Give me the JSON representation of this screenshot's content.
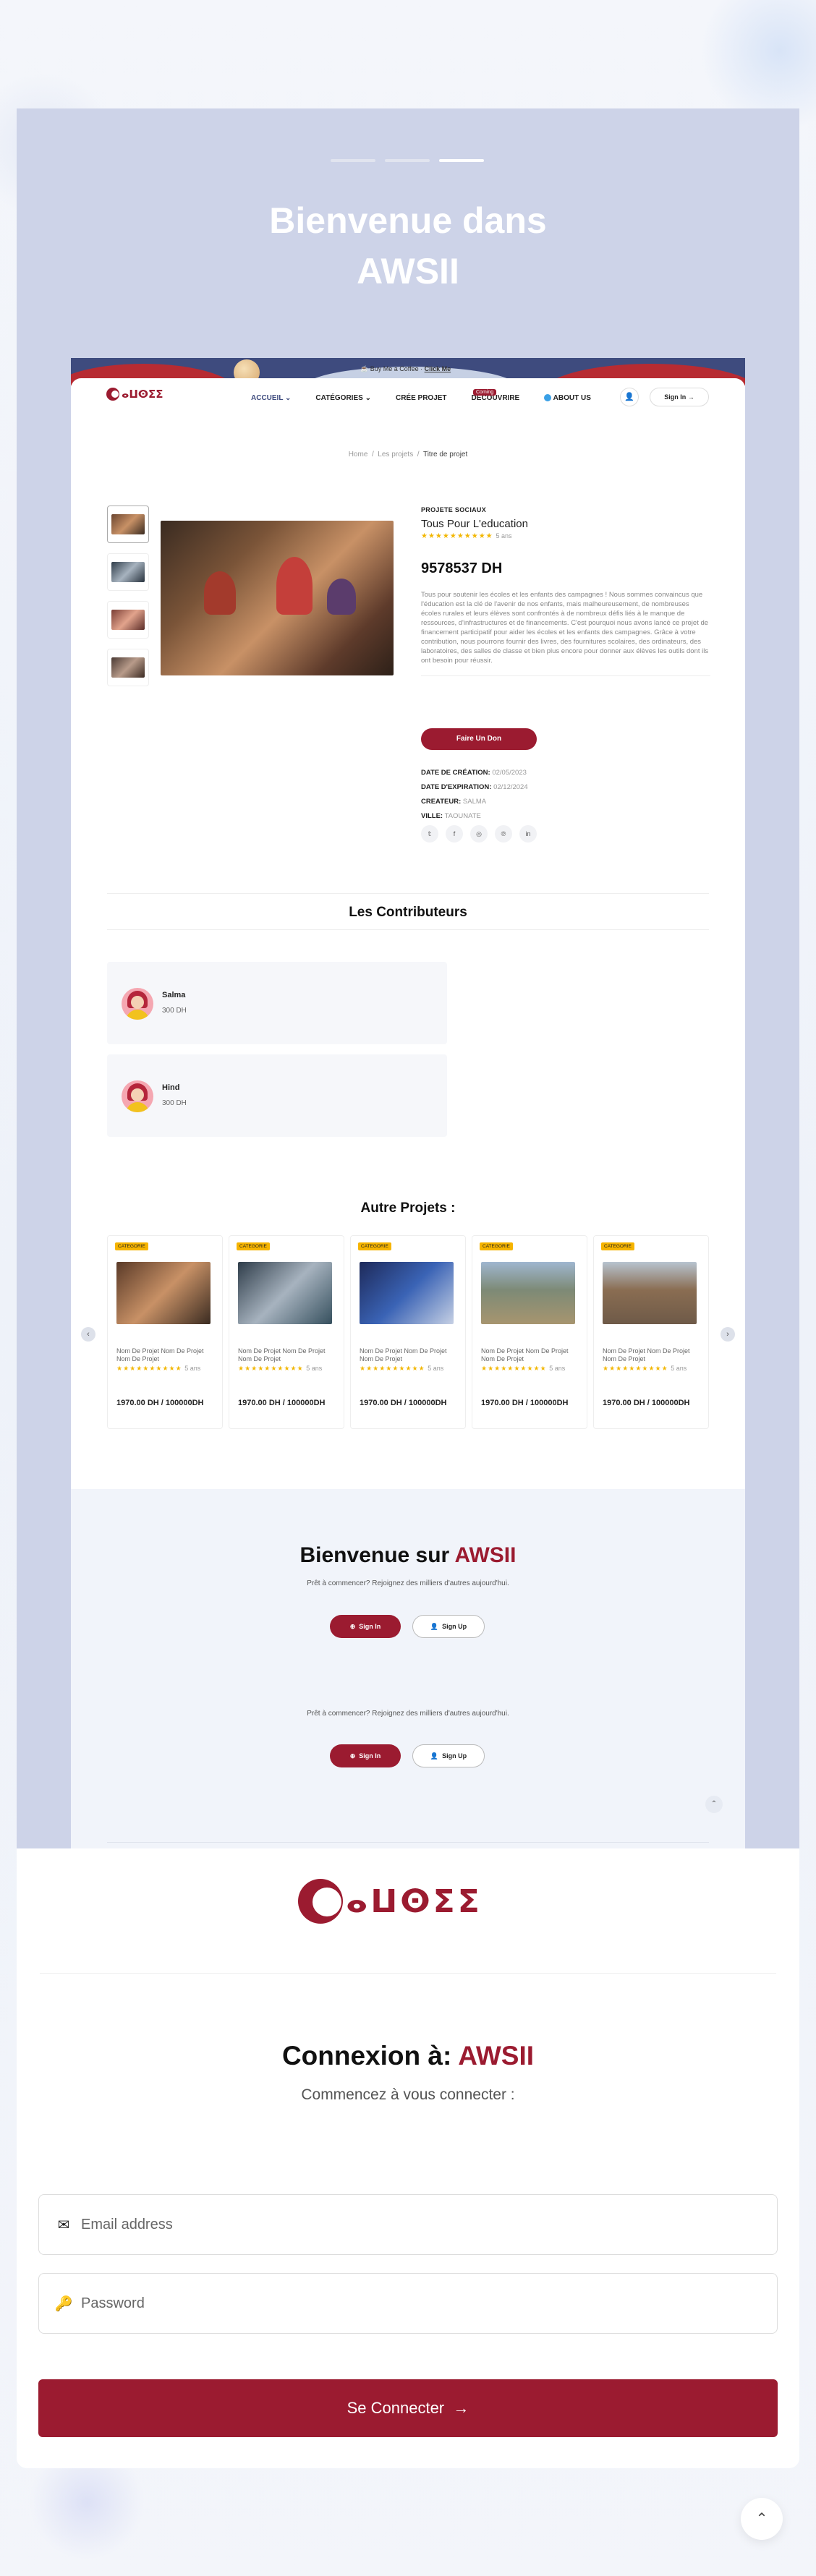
{
  "hero": {
    "title_line1": "Bienvenue dans",
    "title_line2": "AWSII"
  },
  "topbar": {
    "promo": "Buy Me a Coffee",
    "promo_link": "Click Me"
  },
  "nav": {
    "logo_text": "ⴰⵡⵙⵉⵉ",
    "items": [
      {
        "label": "ACCUEIL ⌄"
      },
      {
        "label": "CATÉGORIES ⌄"
      },
      {
        "label": "CRÉE PROJET"
      },
      {
        "label": "DECOUVRIRE"
      },
      {
        "label": "ABOUT US"
      }
    ],
    "badge": "Coming",
    "signin": "Sign In →"
  },
  "breadcrumb": {
    "home": "Home",
    "sep": "/",
    "projects": "Les projets",
    "current": "Titre de projet"
  },
  "project": {
    "category": "PROJETE SOCIAUX",
    "title": "Tous Pour L'education",
    "stars": "★★★★★★★★★★",
    "rating": "5 ans",
    "price": "9578537 DH",
    "description": "Tous pour soutenir les écoles et les enfants des campagnes ! Nous sommes convaincus que l'éducation est la clé de l'avenir de nos enfants, mais malheureusement, de nombreuses écoles rurales et leurs élèves sont confrontés à de nombreux défis liés à le manque de ressources, d'infrastructures et de financements. C'est pourquoi nous avons lancé ce projet de financement participatif pour aider les écoles et les enfants des campagnes. Grâce à votre contribution, nous pourrons fournir des livres, des fournitures scolaires, des ordinateurs, des laboratoires, des salles de classe et bien plus encore pour donner aux élèves les outils dont ils ont besoin pour réussir.",
    "donate": "Faire Un Don",
    "creation_label": "DATE DE CRÉATION:",
    "creation_value": "02/05/2023",
    "expiration_label": "DATE D'EXPIRATION:",
    "expiration_value": "02/12/2024",
    "creator_label": "CREATEUR:",
    "creator_value": "SALMA",
    "city_label": "VILLE:",
    "city_value": "TAOUNATE",
    "socials": [
      "twitter-icon",
      "facebook-icon",
      "instagram-icon",
      "pinterest-icon",
      "linkedin-icon"
    ]
  },
  "contributors": {
    "title": "Les Contributeurs",
    "items": [
      {
        "name": "Salma",
        "amount": "300 DH"
      },
      {
        "name": "Hind",
        "amount": "300 DH"
      }
    ]
  },
  "others": {
    "title": "Autre Projets :",
    "cards": [
      {
        "category": "CATEGORIE",
        "name": "Nom De Projet Nom De Projet Nom De Projet",
        "stars": "★★★★★★★★★★",
        "rating": "5 ans",
        "price": "1970.00 DH / 100000DH"
      },
      {
        "category": "CATEGORIE",
        "name": "Nom De Projet Nom De Projet Nom De Projet",
        "stars": "★★★★★★★★★★",
        "rating": "5 ans",
        "price": "1970.00 DH / 100000DH"
      },
      {
        "category": "CATEGORIE",
        "name": "Nom De Projet Nom De Projet Nom De Projet",
        "stars": "★★★★★★★★★★",
        "rating": "5 ans",
        "price": "1970.00 DH / 100000DH"
      },
      {
        "category": "CATEGORIE",
        "name": "Nom De Projet Nom De Projet Nom De Projet",
        "stars": "★★★★★★★★★★",
        "rating": "5 ans",
        "price": "1970.00 DH / 100000DH"
      },
      {
        "category": "CATEGORIE",
        "name": "Nom De Projet Nom De Projet Nom De Projet",
        "stars": "★★★★★★★★★★",
        "rating": "5 ans",
        "price": "1970.00 DH / 100000DH"
      }
    ]
  },
  "cta": {
    "title": "Bienvenue sur",
    "brand": "AWSII",
    "subtitle": "Prêt à commencer? Rejoignez des milliers d'autres aujourd'hui.",
    "subtitle2": "Prêt à commencer? Rejoignez des milliers d'autres aujourd'hui.",
    "signin": "Sign In",
    "signup": "Sign Up"
  },
  "login": {
    "logo_text": "ⴰⵡⵙⵉⵉ",
    "title": "Connexion à:",
    "brand": "AWSII",
    "subtitle": "Commencez à vous connecter :",
    "email_placeholder": "Email address",
    "password_placeholder": "Password",
    "submit": "Se Connecter"
  },
  "colors": {
    "brand": "#9b1b30",
    "hero_bg": "#cdd3e8",
    "navy": "#3e4b7e",
    "category_badge": "#f6b400"
  }
}
